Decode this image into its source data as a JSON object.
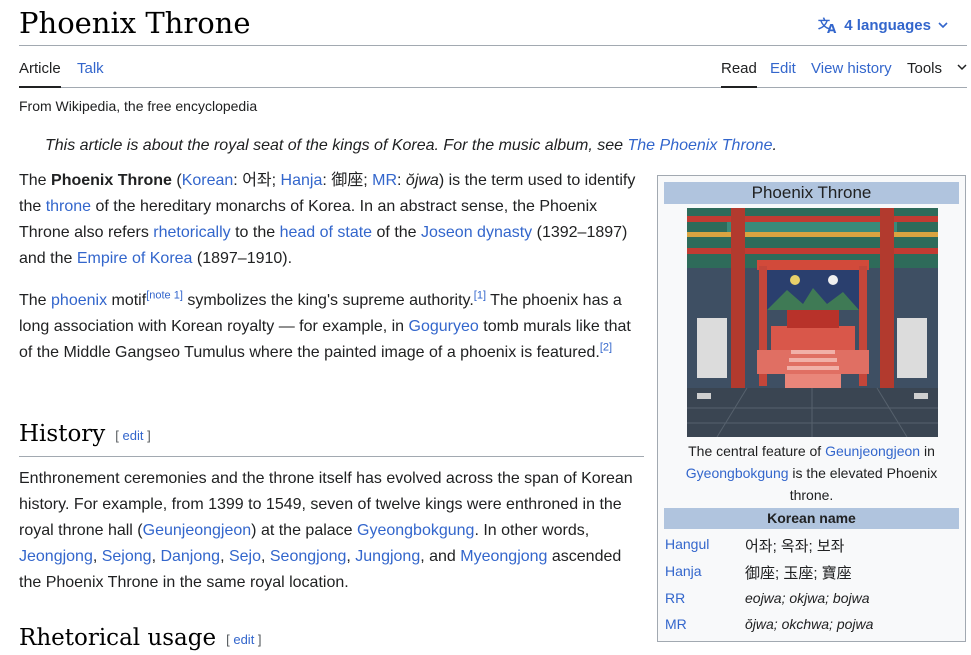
{
  "page": {
    "title": "Phoenix Throne",
    "languages_label": "4 languages",
    "tagline": "From Wikipedia, the free encyclopedia"
  },
  "tabs": {
    "article": "Article",
    "talk": "Talk",
    "read": "Read",
    "edit": "Edit",
    "view_history": "View history",
    "tools": "Tools"
  },
  "hatnote": {
    "text": "This article is about the royal seat of the kings of Korea. For the music album, see ",
    "link": "The Phoenix Throne",
    "end": "."
  },
  "intro": {
    "p1": {
      "t1": "The ",
      "bold": "Phoenix Throne",
      "t2": " (",
      "l_korean": "Korean",
      "t3": ": 어좌; ",
      "l_hanja": "Hanja",
      "t4": ": 御座; ",
      "l_mr": "MR",
      "t5": ": ",
      "mr_val": "ŏjwa",
      "t6": ") is the term used to identify the ",
      "l_throne": "throne",
      "t7": " of the hereditary monarchs of Korea. In an abstract sense, the Phoenix Throne also refers ",
      "l_rhet": "rhetorically",
      "t8": " to the ",
      "l_head": "head of state",
      "t9": " of the ",
      "l_joseon": "Joseon dynasty",
      "t10": " (1392–1897) and the ",
      "l_empire": "Empire of Korea",
      "t11": " (1897–1910)."
    },
    "p2": {
      "t1": "The ",
      "l_phoenix": "phoenix",
      "t2": " motif",
      "note1": "[note 1]",
      "t3": " symbolizes the king's supreme authority.",
      "ref1": "[1]",
      "t4": " The phoenix has a long association with Korean royalty — for example, in ",
      "l_goguryeo": "Goguryeo",
      "t5": " tomb murals like that of the Middle Gangseo Tumulus where the painted image of a phoenix is featured.",
      "ref2": "[2]"
    }
  },
  "history": {
    "heading": "History",
    "edit_open": "[ ",
    "edit_label": "edit",
    "edit_close": " ]",
    "p": {
      "t1": "Enthronement ceremonies and the throne itself has evolved across the span of Korean history. For example, from 1399 to 1549, seven of twelve kings were enthroned in the royal throne hall (",
      "l_geun": "Geunjeongjeon",
      "t2": ") at the palace ",
      "l_gyeong": "Gyeongbokgung",
      "t3": ". In other words, ",
      "l_jeong": "Jeongjong",
      "s1": ", ",
      "l_sejong": "Sejong",
      "s2": ", ",
      "l_danjong": "Danjong",
      "s3": ", ",
      "l_sejo": "Sejo",
      "s4": ", ",
      "l_seong": "Seongjong",
      "s5": ", ",
      "l_jung": "Jungjong",
      "s6": ", and ",
      "l_myeong": "Myeongjong",
      "t4": " ascended the Phoenix Throne in the same royal location."
    }
  },
  "rhetorical": {
    "heading": "Rhetorical usage",
    "edit_open": "[ ",
    "edit_label": "edit",
    "edit_close": " ]"
  },
  "infobox": {
    "title": "Phoenix Throne",
    "caption": {
      "t1": "The central feature of ",
      "l1": "Geunjeongjeon",
      "t2": " in ",
      "l2": "Gyeongbokgung",
      "t3": " is the elevated Phoenix throne."
    },
    "section": "Korean name",
    "rows": [
      {
        "label": "Hangul",
        "value": "어좌; 옥좌; 보좌"
      },
      {
        "label": "Hanja",
        "value": "御座; 玉座; 寶座"
      },
      {
        "label": "RR",
        "value": "eojwa; okjwa; bojwa"
      },
      {
        "label": "MR",
        "value": "ŏjwa; okchwa; pojwa"
      }
    ]
  },
  "colors": {
    "link": "#3366cc",
    "text": "#202122",
    "infobox_header": "#b0c4de",
    "border": "#a2a9b1"
  }
}
